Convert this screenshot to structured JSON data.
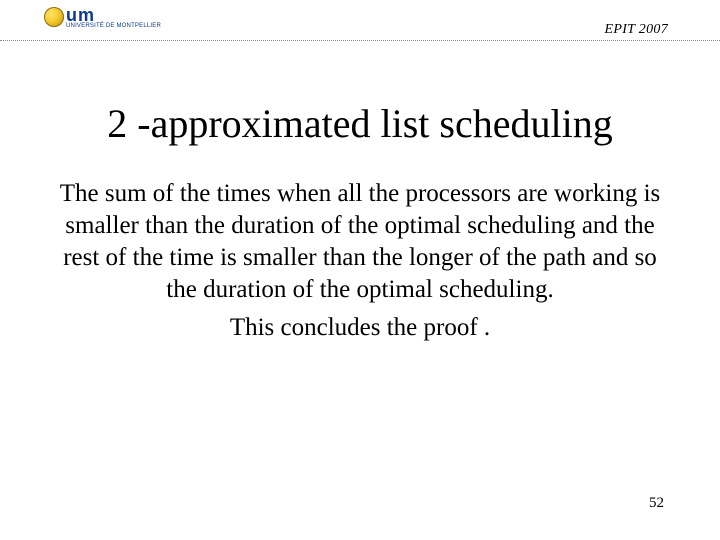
{
  "header": {
    "logo_name": "um",
    "logo_sub": "UNIVERSITÉ DE MONTPELLIER",
    "conference": "EPIT 2007"
  },
  "title": "2 -approximated list scheduling",
  "body": {
    "p1": "The sum of the times when all the processors are working is smaller than the duration of the optimal scheduling and the rest of the time is smaller than the longer of the path and so the duration of the optimal scheduling.",
    "p2": "This concludes the proof ."
  },
  "page_number": "52"
}
